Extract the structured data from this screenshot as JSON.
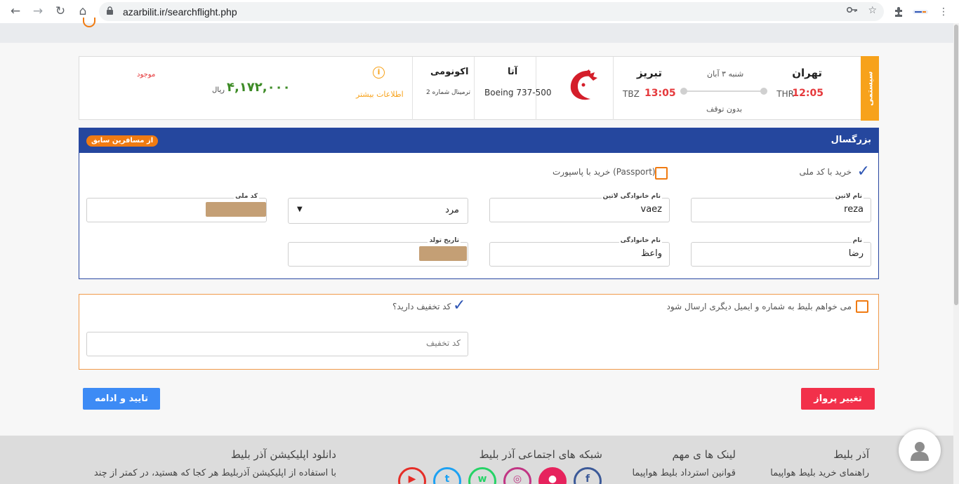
{
  "browser": {
    "url": "azarbilit.ir/searchflight.php",
    "back_icon": "←",
    "forward_icon": "→",
    "reload_icon": "↻",
    "home_icon": "⌂"
  },
  "flight": {
    "system_label": "سیستمی",
    "origin_city": "تهران",
    "origin_code": "THR",
    "departure_time": "12:05",
    "date": "شنبه ۳ آبان",
    "stops": "بدون توقف",
    "dest_city": "تبریز",
    "dest_code": "TBZ",
    "arrival_time": "13:05",
    "airline": "آتا",
    "aircraft": "Boeing 737-500",
    "cabin": "اکونومی",
    "terminal": "ترمینال شماره 2",
    "more_info": "اطلاعات بیشتر",
    "price": "۴,۱۷۲,۰۰۰",
    "currency": "ریال",
    "availability": "موجود"
  },
  "passenger": {
    "title": "بزرگسال",
    "previous_button": "از مسافرین سابق",
    "national_code_option": "خرید با کد ملی",
    "passport_option": "خرید با پاسپورت (Passport)",
    "latin_first_label": "نام لاتین",
    "latin_first_value": "reza",
    "latin_last_label": "نام خانوادگی لاتین",
    "latin_last_value": "vaez",
    "gender_value": "مرد",
    "national_code_label": "کد ملی",
    "first_name_label": "نام",
    "first_name_value": "رضا",
    "last_name_label": "نام خانوادگی",
    "last_name_value": "واعظ",
    "birth_date_label": "تاریخ تولد"
  },
  "discount": {
    "send_other_label": "می خواهم بلیط به شماره و ایمیل دیگری ارسال شود",
    "have_code_label": "کد تخفیف دارید؟",
    "code_placeholder": "کد تخفیف"
  },
  "actions": {
    "change_flight": "تغییر پرواز",
    "confirm": "تایید و ادامه"
  },
  "footer": {
    "col1_title": "آذر بلیط",
    "col1_line": "راهنمای خرید بلیط هواپیما",
    "col2_title": "لینک ها ی مهم",
    "col2_line": "قوانین استرداد بلیط هواپیما",
    "col3_title": "شبکه های اجتماعی آذر بلیط",
    "col4_title": "دانلود اپلیکیشن آذر بلیط",
    "col4_line": "با استفاده از اپلیکیشن آذربلیط هر کجا که هستید، در کمتر از چند"
  },
  "colors": {
    "primary_blue": "#25479e",
    "orange": "#f07b12",
    "system_tab": "#f7a21b",
    "red_time": "#e5383b",
    "price_green": "#3d8b26",
    "change_btn": "#f2304a",
    "confirm_btn": "#3d8bf5"
  }
}
